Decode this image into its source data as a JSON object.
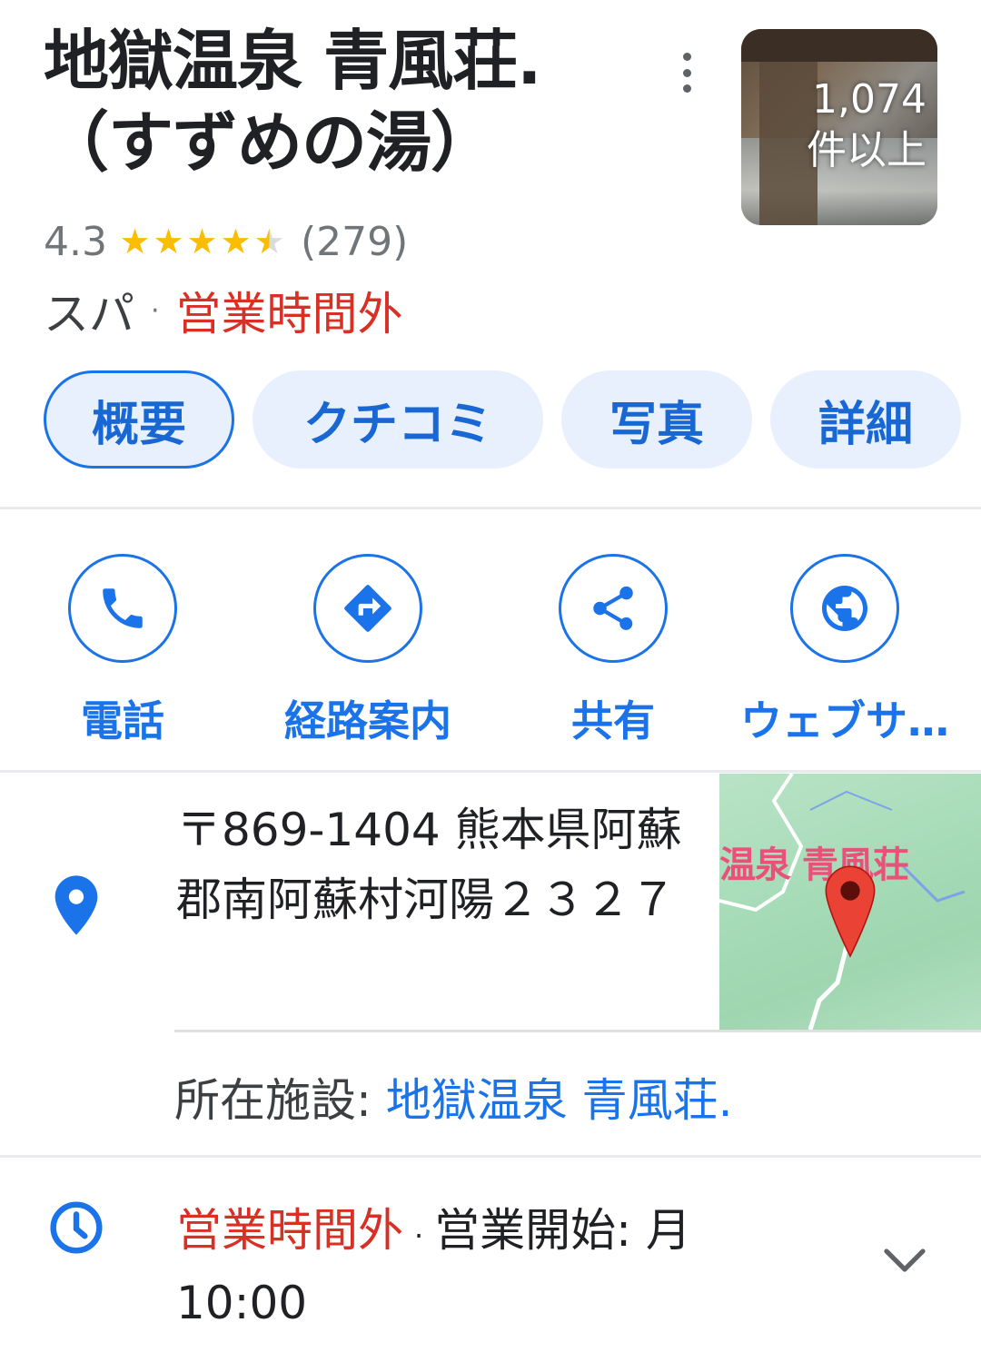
{
  "place": {
    "title_line1": "地獄温泉 青風荘.",
    "title_line2": "（すずめの湯）",
    "photo_count_line1": "1,074",
    "photo_count_line2": "件以上",
    "rating": "4.3",
    "rating_stars": 4.3,
    "review_count": "(279)",
    "category": "スパ",
    "separator": "·",
    "status": "営業時間外"
  },
  "tabs": [
    {
      "label": "概要",
      "active": true
    },
    {
      "label": "クチコミ",
      "active": false
    },
    {
      "label": "写真",
      "active": false
    },
    {
      "label": "詳細",
      "active": false
    }
  ],
  "actions": [
    {
      "label": "電話",
      "icon": "phone-icon"
    },
    {
      "label": "経路案内",
      "icon": "directions-icon"
    },
    {
      "label": "共有",
      "icon": "share-icon"
    },
    {
      "label": "ウェブサ…",
      "icon": "globe-icon"
    }
  ],
  "address": {
    "text": "〒869-1404 熊本県阿蘇郡南阿蘇村河陽２３２７",
    "map_label": "温泉 青風荘",
    "facility_prefix": "所在施設: ",
    "facility_link": "地獄温泉 青風荘."
  },
  "hours": {
    "status": "営業時間外",
    "separator": "·",
    "next_open": "営業開始: 月 10:00"
  },
  "colors": {
    "accent": "#1a73e8",
    "closed": "#d93025",
    "star": "#fbbc04",
    "tab_bg": "#e8f0fe"
  }
}
